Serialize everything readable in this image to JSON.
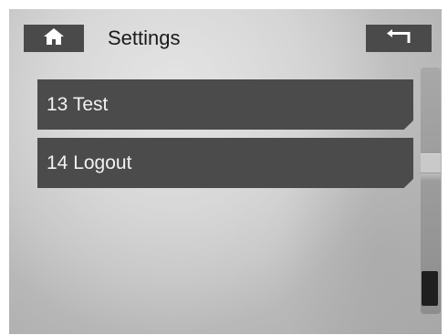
{
  "header": {
    "home_icon": "home-icon",
    "title": "Settings",
    "back_icon": "back-arrow-icon"
  },
  "menu": {
    "items": [
      {
        "label": "13 Test"
      },
      {
        "label": "14 Logout"
      }
    ]
  },
  "scrollbar": {
    "position": 1.0
  },
  "colors": {
    "button_bg": "#4a4a4a",
    "item_bg": "#4b4b4b",
    "item_text": "#f2f2f2",
    "thumb": "#1f1f1f"
  }
}
